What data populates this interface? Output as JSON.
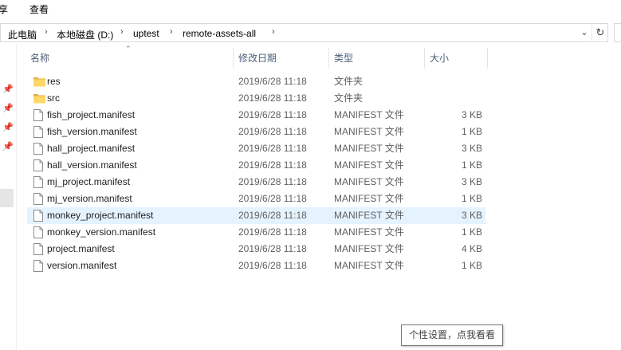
{
  "menu": {
    "share": "享",
    "view": "查看"
  },
  "address": {
    "crumbs": [
      "此电脑",
      "本地磁盘 (D:)",
      "uptest",
      "remote-assets-all"
    ],
    "separator": "›",
    "dropdown_icon": "chevron-down-icon",
    "refresh_icon": "refresh-icon"
  },
  "columns": {
    "name": "名称",
    "modified": "修改日期",
    "type": "类型",
    "size": "大小"
  },
  "files": [
    {
      "name": "res",
      "date": "2019/6/28 11:18",
      "type": "文件夹",
      "size": "",
      "icon": "folder-icon"
    },
    {
      "name": "src",
      "date": "2019/6/28 11:18",
      "type": "文件夹",
      "size": "",
      "icon": "folder-icon"
    },
    {
      "name": "fish_project.manifest",
      "date": "2019/6/28 11:18",
      "type": "MANIFEST 文件",
      "size": "3 KB",
      "icon": "file-icon"
    },
    {
      "name": "fish_version.manifest",
      "date": "2019/6/28 11:18",
      "type": "MANIFEST 文件",
      "size": "1 KB",
      "icon": "file-icon"
    },
    {
      "name": "hall_project.manifest",
      "date": "2019/6/28 11:18",
      "type": "MANIFEST 文件",
      "size": "3 KB",
      "icon": "file-icon"
    },
    {
      "name": "hall_version.manifest",
      "date": "2019/6/28 11:18",
      "type": "MANIFEST 文件",
      "size": "1 KB",
      "icon": "file-icon"
    },
    {
      "name": "mj_project.manifest",
      "date": "2019/6/28 11:18",
      "type": "MANIFEST 文件",
      "size": "3 KB",
      "icon": "file-icon"
    },
    {
      "name": "mj_version.manifest",
      "date": "2019/6/28 11:18",
      "type": "MANIFEST 文件",
      "size": "1 KB",
      "icon": "file-icon"
    },
    {
      "name": "monkey_project.manifest",
      "date": "2019/6/28 11:18",
      "type": "MANIFEST 文件",
      "size": "3 KB",
      "icon": "file-icon",
      "selected": true
    },
    {
      "name": "monkey_version.manifest",
      "date": "2019/6/28 11:18",
      "type": "MANIFEST 文件",
      "size": "1 KB",
      "icon": "file-icon"
    },
    {
      "name": "project.manifest",
      "date": "2019/6/28 11:18",
      "type": "MANIFEST 文件",
      "size": "4 KB",
      "icon": "file-icon"
    },
    {
      "name": "version.manifest",
      "date": "2019/6/28 11:18",
      "type": "MANIFEST 文件",
      "size": "1 KB",
      "icon": "file-icon"
    }
  ],
  "tooltip": "个性设置，点我看看",
  "colors": {
    "selected_row": "#e5f3ff",
    "folder": "#ffd767",
    "header_text": "#4c607a"
  }
}
